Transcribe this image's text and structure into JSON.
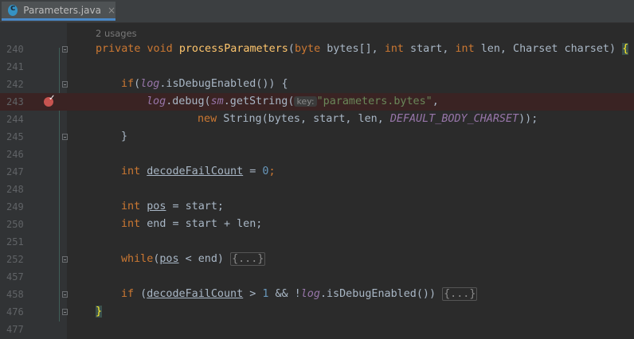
{
  "tab": {
    "title": "Parameters.java",
    "close": "×"
  },
  "usages_hint": "2 usages",
  "lines": {
    "l240": {
      "num": "240",
      "kw1": "private",
      "kw2": "void",
      "name": "processParameters",
      "p0": "(",
      "kw3": "byte",
      "p1": " bytes[], ",
      "kw4": "int",
      "p2": " start, ",
      "kw5": "int",
      "p3": " len, Charset charset) ",
      "brace": "{"
    },
    "l241": {
      "num": "241"
    },
    "l242": {
      "num": "242",
      "kw": "if",
      "p0": "(",
      "log": "log",
      "p1": ".isDebugEnabled()) {"
    },
    "l243": {
      "num": "243",
      "log": "log",
      "p0": ".debug(",
      "sm": "sm",
      "p1": ".getString(",
      "pill": "key:",
      "str": "\"parameters.bytes\"",
      "p2": ","
    },
    "l244": {
      "num": "244",
      "kw": "new",
      "p0": " String(bytes, start, len, ",
      "const": "DEFAULT_BODY_CHARSET",
      "p1": "));"
    },
    "l245": {
      "num": "245",
      "p0": "}"
    },
    "l246": {
      "num": "246"
    },
    "l247": {
      "num": "247",
      "kw": "int",
      "var": "decodeFailCount",
      "p0": " = ",
      "n": "0",
      "p1": ";"
    },
    "l248": {
      "num": "248"
    },
    "l249": {
      "num": "249",
      "kw": "int",
      "var": "pos",
      "p0": " = start;"
    },
    "l250": {
      "num": "250",
      "kw": "int",
      "p0": " end = start + len;"
    },
    "l251": {
      "num": "251"
    },
    "l252": {
      "num": "252",
      "kw": "while",
      "p0": "(",
      "var": "pos",
      "p1": " < end) ",
      "fold": "{...}"
    },
    "l457": {
      "num": "457"
    },
    "l458": {
      "num": "458",
      "kw": "if",
      "p0": " (",
      "var": "decodeFailCount",
      "p1": " > ",
      "n": "1",
      "p2": " && !",
      "log": "log",
      "p3": ".isDebugEnabled()) ",
      "fold": "{...}"
    },
    "l476": {
      "num": "476",
      "brace": "}"
    },
    "l477": {
      "num": "477"
    }
  },
  "colors": {
    "keyword": "#cc7832",
    "method": "#ffc66d",
    "field": "#9876aa",
    "number": "#6897bb",
    "string": "#6a8759",
    "breakpoint": "#c75450"
  }
}
